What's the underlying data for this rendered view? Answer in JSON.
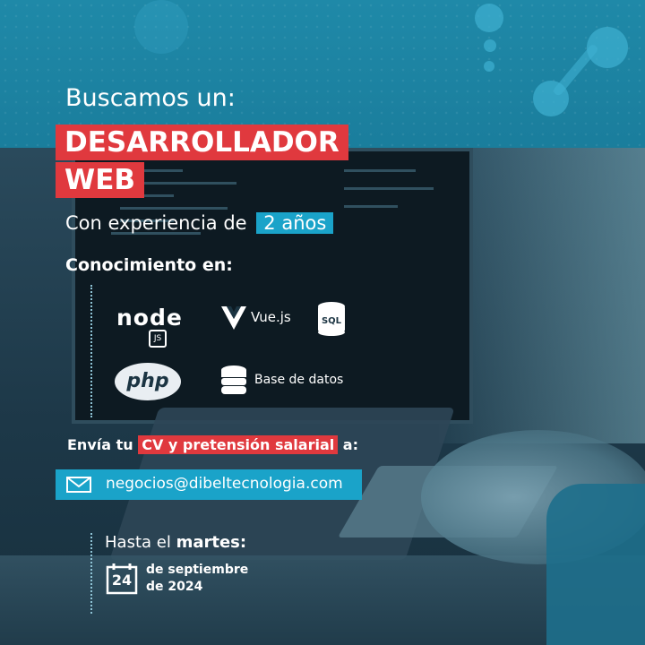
{
  "header": {
    "intro": "Buscamos un:"
  },
  "title": {
    "line1": "DESARROLLADOR",
    "line2": "WEB"
  },
  "experience": {
    "text": "Con experiencia de",
    "highlight": "2 años"
  },
  "skills": {
    "heading": "Conocimiento en:",
    "items": [
      {
        "label": "node",
        "sub": "JS",
        "icon": "nodejs-logo-icon"
      },
      {
        "label": "Vue.js",
        "icon": "vue-logo-icon"
      },
      {
        "label": "SQL",
        "icon": "sql-database-icon"
      },
      {
        "label": "php",
        "icon": "php-logo-icon"
      },
      {
        "label": "Base de datos",
        "icon": "database-stack-icon"
      }
    ]
  },
  "apply": {
    "prefix": "Envía tu",
    "highlight": "CV y pretensión salarial",
    "suffix": "a:",
    "email": "negocios@dibeltecnologia.com",
    "email_icon": "envelope-icon"
  },
  "deadline": {
    "prefix": "Hasta el",
    "day_name": "martes:",
    "day": "24",
    "line1": "de septiembre",
    "line2": "de 2024",
    "icon": "calendar-icon"
  },
  "colors": {
    "accent_red": "#e0393e",
    "accent_cyan": "#1aa3c9",
    "band": "#1f89a8"
  }
}
